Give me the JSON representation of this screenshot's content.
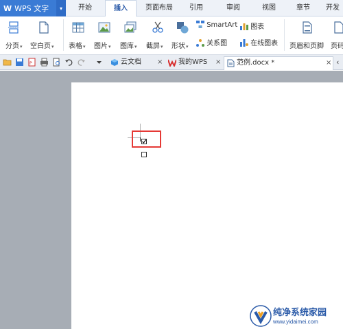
{
  "app": {
    "logo": "W",
    "title": "WPS 文字",
    "arrow": "▾"
  },
  "menu_tabs": [
    "开始",
    "插入",
    "页面布局",
    "引用",
    "审阅",
    "视图",
    "章节",
    "开发"
  ],
  "active_menu_tab": "插入",
  "ribbon": {
    "page_break": "分页",
    "blank_page": "空白页",
    "table": "表格",
    "picture": "图片",
    "gallery": "图库",
    "screenshot": "截屏",
    "shapes": "形状",
    "smartart": "SmartArt",
    "chart": "图表",
    "relation": "关系图",
    "online_chart": "在线图表",
    "header_footer": "页眉和页脚",
    "page_number": "页码"
  },
  "doc_tabs": [
    {
      "label": "云文档",
      "close": "×"
    },
    {
      "label": "我的WPS",
      "close": "×"
    },
    {
      "label": "范例.docx *",
      "close": "×"
    }
  ],
  "tab_overflow": "‹",
  "colors": {
    "accent": "#3a7bd5",
    "highlight": "#e53935",
    "workspace": "#a7adb5"
  },
  "document": {
    "checkbox_checked": "☑"
  },
  "watermark": {
    "title": "纯净系统家园",
    "url": "www.yidaimei.com"
  }
}
